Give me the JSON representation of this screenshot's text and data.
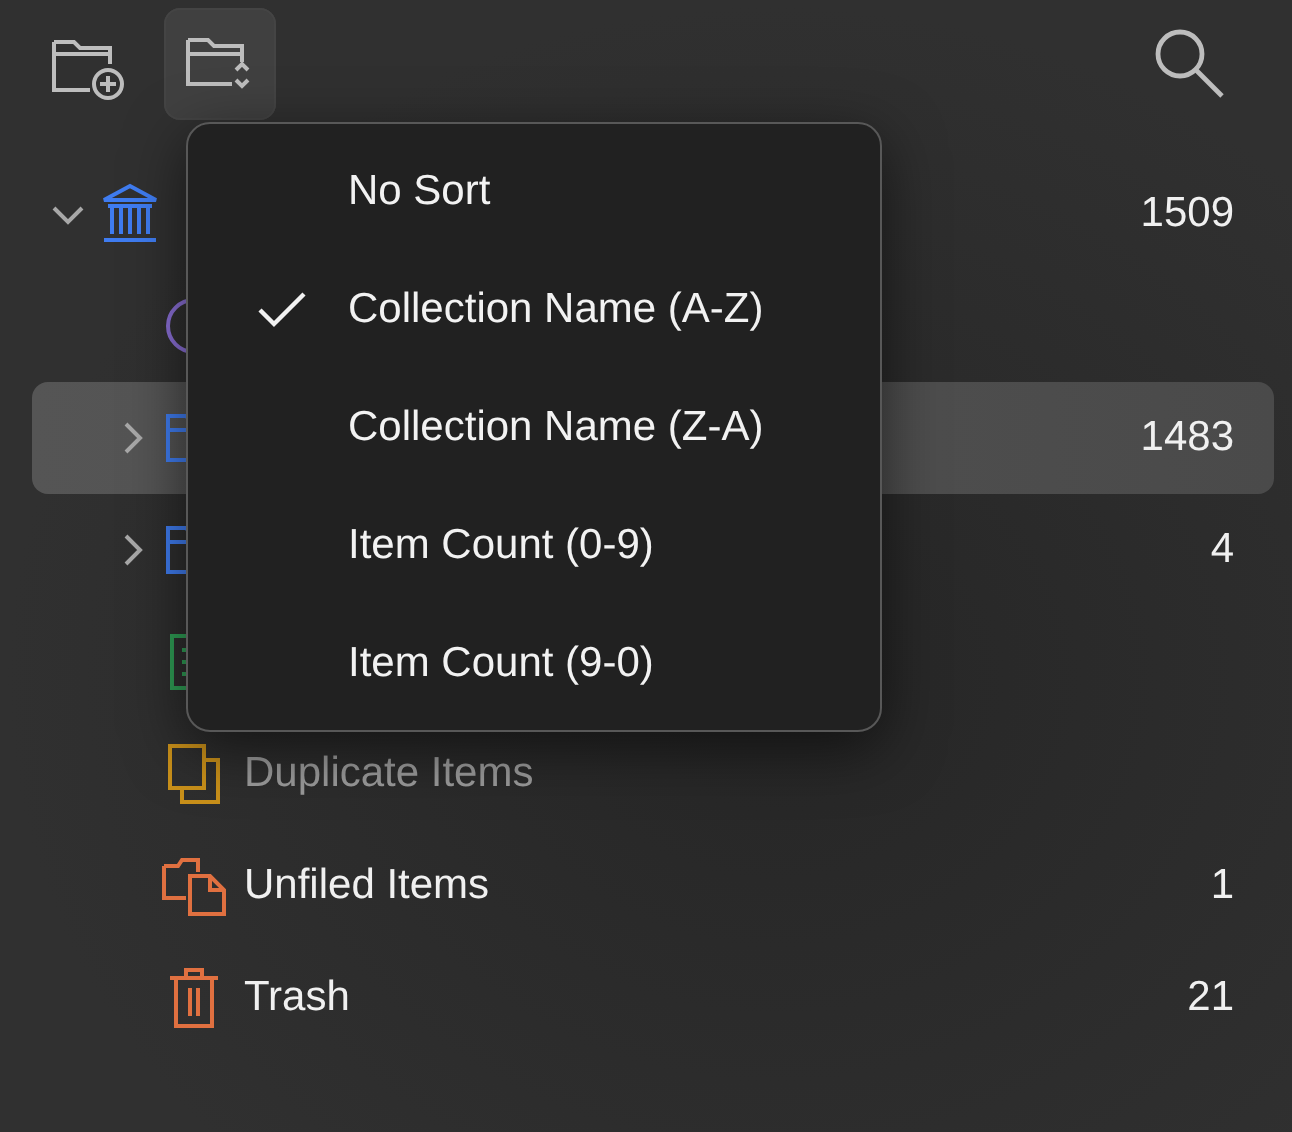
{
  "toolbar": [
    {
      "kind": "new-collection",
      "pressed": false
    },
    {
      "kind": "sort",
      "pressed": true
    },
    {
      "kind": "search",
      "pressed": false
    }
  ],
  "tree": [
    {
      "kind": "library",
      "count": "1509",
      "expanded": true,
      "selected": false,
      "disabled": false,
      "children": [
        {
          "kind": "circle",
          "selected": false,
          "disabled": false
        },
        {
          "kind": "folder",
          "count": "1483",
          "expanded": false,
          "selected": true,
          "disabled": false
        },
        {
          "kind": "folder",
          "count": "4",
          "expanded": false,
          "selected": false,
          "disabled": false
        },
        {
          "kind": "sheet",
          "selected": false,
          "disabled": false
        },
        {
          "kind": "duplicate",
          "label": "Duplicate Items",
          "selected": false,
          "disabled": true
        },
        {
          "kind": "unfiled",
          "label": "Unfiled Items",
          "count": "1",
          "selected": false,
          "disabled": false
        },
        {
          "kind": "trash",
          "label": "Trash",
          "count": "21",
          "selected": false,
          "disabled": false
        }
      ]
    }
  ],
  "sort_menu": [
    {
      "label": "No Sort",
      "checked": false
    },
    {
      "label": "Collection Name (A-Z)",
      "checked": true
    },
    {
      "label": "Collection Name (Z-A)",
      "checked": false
    },
    {
      "label": "Item Count (0-9)",
      "checked": false
    },
    {
      "label": "Item Count (9-0)",
      "checked": false
    }
  ]
}
